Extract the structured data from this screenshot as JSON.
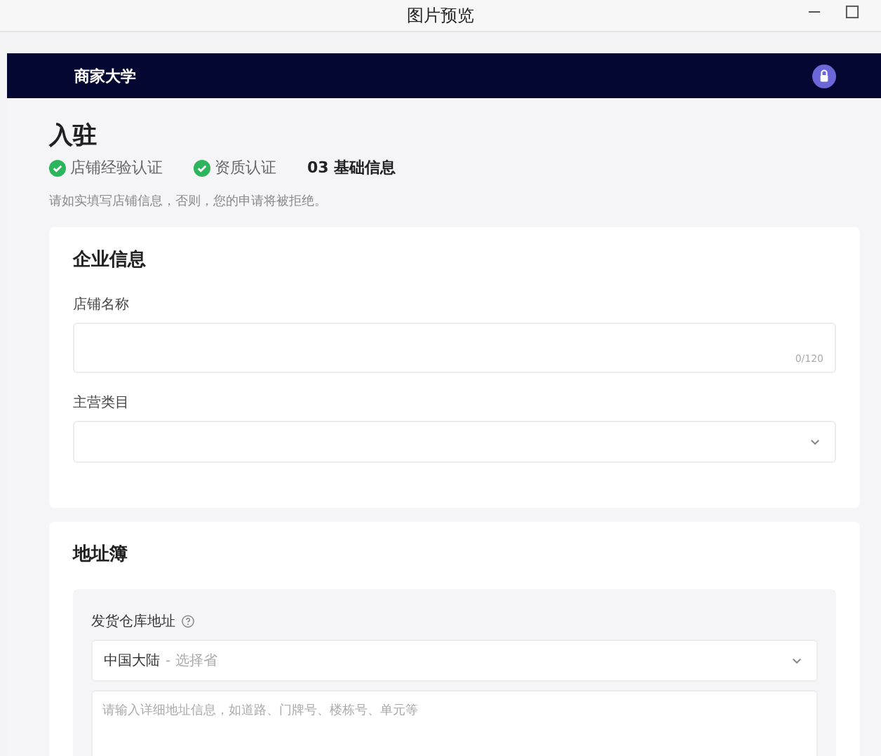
{
  "window": {
    "title": "图片预览"
  },
  "header": {
    "brand": "商家大学"
  },
  "page": {
    "title": "入驻",
    "steps": [
      {
        "label": "店铺经验认证",
        "done": true
      },
      {
        "label": "资质认证",
        "done": true
      },
      {
        "label": "03 基础信息",
        "done": false
      }
    ],
    "hint": "请如实填写店铺信息，否则，您的申请将被拒绝。"
  },
  "sections": [
    {
      "title": "企业信息",
      "fields": [
        {
          "kind": "text",
          "label": "店铺名称",
          "counter": "0/120"
        },
        {
          "kind": "select",
          "label": "主营类目"
        }
      ]
    },
    {
      "title": "地址簿",
      "panel": {
        "label": "发货仓库地址",
        "region": "中国大陆",
        "region_placeholder": "- 选择省",
        "address_placeholder": "请输入详细地址信息，如道路、门牌号、楼栋号、单元等"
      }
    }
  ]
}
